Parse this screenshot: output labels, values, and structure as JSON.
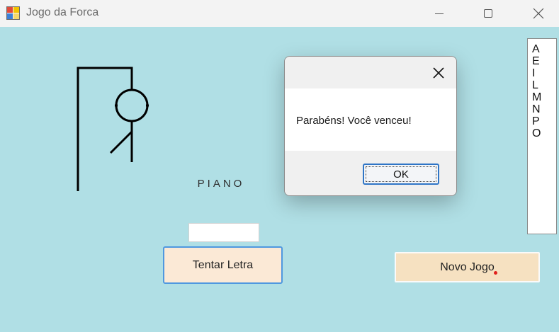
{
  "window": {
    "title": "Jogo da Forca",
    "controls": [
      "minimize-icon",
      "maximize-icon",
      "close-icon"
    ]
  },
  "game": {
    "word": "PIANO",
    "letter_input_value": "",
    "try_button": "Tentar Letra",
    "new_game_button": "Novo Jogo",
    "used_letters": [
      "A",
      "E",
      "I",
      "L",
      "M",
      "N",
      "P",
      "O"
    ]
  },
  "dialog": {
    "message": "Parabéns! Você venceu!",
    "ok_button": "OK"
  },
  "colors": {
    "background": "#b0dfe5",
    "try_button_bg": "#fbe9d6",
    "new_game_bg": "#f6e1c1",
    "accent": "#2f75c6"
  }
}
